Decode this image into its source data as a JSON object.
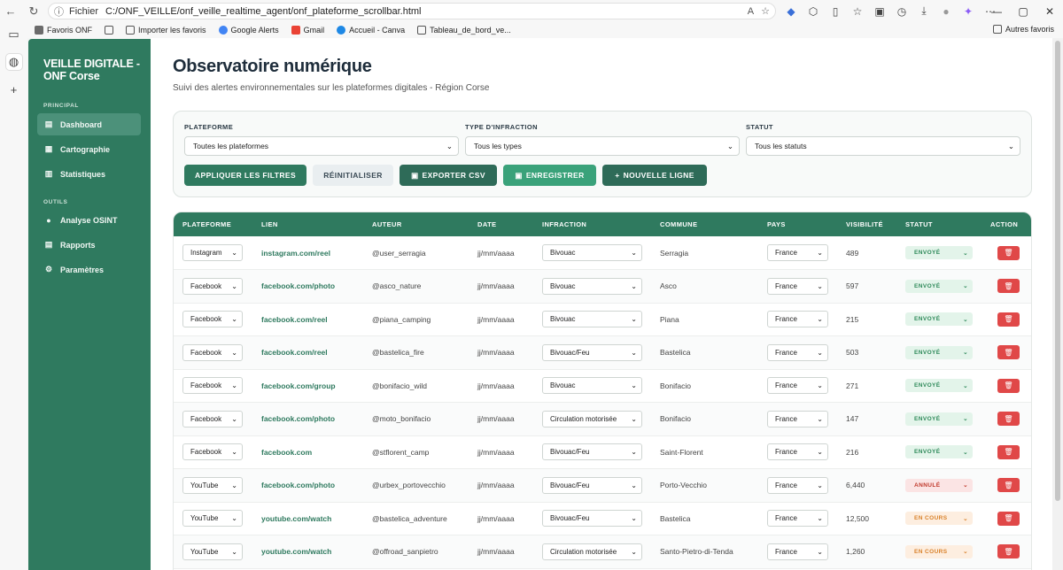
{
  "browser": {
    "url_label": "Fichier",
    "url": "C:/ONF_VEILLE/onf_veille_realtime_agent/onf_plateforme_scrollbar.html",
    "bookmarks": [
      "Favoris ONF",
      "Importer les favoris",
      "Google Alerts",
      "Gmail",
      "Accueil - Canva",
      "Tableau_de_bord_ve..."
    ],
    "other_bookmarks": "Autres favoris"
  },
  "sidebar": {
    "brand": "VEILLE DIGITALE - ONF Corse",
    "section_principal": "PRINCIPAL",
    "section_outils": "OUTILS",
    "principal_items": [
      {
        "label": "Dashboard",
        "icon": "chart-icon"
      },
      {
        "label": "Cartographie",
        "icon": "map-icon"
      },
      {
        "label": "Statistiques",
        "icon": "stats-icon"
      }
    ],
    "outils_items": [
      {
        "label": "Analyse OSINT",
        "icon": "dot-icon"
      },
      {
        "label": "Rapports",
        "icon": "report-icon"
      },
      {
        "label": "Paramètres",
        "icon": "gear-icon"
      }
    ]
  },
  "header": {
    "title": "Observatoire numérique",
    "subtitle": "Suivi des alertes environnementales sur les plateformes digitales - Région Corse"
  },
  "filters": {
    "platform_label": "PLATEFORME",
    "platform_value": "Toutes les plateformes",
    "type_label": "TYPE D'INFRACTION",
    "type_value": "Tous les types",
    "status_label": "STATUT",
    "status_value": "Tous les statuts",
    "apply": "APPLIQUER LES FILTRES",
    "reset": "RÉINITIALISER",
    "export": "EXPORTER CSV",
    "save": "ENREGISTRER",
    "new_line": "NOUVELLE LIGNE"
  },
  "table": {
    "headers": [
      "PLATEFORME",
      "LIEN",
      "AUTEUR",
      "DATE",
      "INFRACTION",
      "COMMUNE",
      "PAYS",
      "VISIBILITÉ",
      "STATUT",
      "ACTION"
    ],
    "rows": [
      {
        "platform": "Instagram",
        "link": "instagram.com/reel",
        "author": "@user_serragia",
        "date": "jj/mm/aaaa",
        "infraction": "Bivouac",
        "commune": "Serragia",
        "country": "France",
        "visibility": "489",
        "status": "ENVOYÉ",
        "status_kind": "envoye"
      },
      {
        "platform": "Facebook",
        "link": "facebook.com/photo",
        "author": "@asco_nature",
        "date": "jj/mm/aaaa",
        "infraction": "Bivouac",
        "commune": "Asco",
        "country": "France",
        "visibility": "597",
        "status": "ENVOYÉ",
        "status_kind": "envoye"
      },
      {
        "platform": "Facebook",
        "link": "facebook.com/reel",
        "author": "@piana_camping",
        "date": "jj/mm/aaaa",
        "infraction": "Bivouac",
        "commune": "Piana",
        "country": "France",
        "visibility": "215",
        "status": "ENVOYÉ",
        "status_kind": "envoye"
      },
      {
        "platform": "Facebook",
        "link": "facebook.com/reel",
        "author": "@bastelica_fire",
        "date": "jj/mm/aaaa",
        "infraction": "Bivouac/Feu",
        "commune": "Bastelica",
        "country": "France",
        "visibility": "503",
        "status": "ENVOYÉ",
        "status_kind": "envoye"
      },
      {
        "platform": "Facebook",
        "link": "facebook.com/group",
        "author": "@bonifacio_wild",
        "date": "jj/mm/aaaa",
        "infraction": "Bivouac",
        "commune": "Bonifacio",
        "country": "France",
        "visibility": "271",
        "status": "ENVOYÉ",
        "status_kind": "envoye"
      },
      {
        "platform": "Facebook",
        "link": "facebook.com/photo",
        "author": "@moto_bonifacio",
        "date": "jj/mm/aaaa",
        "infraction": "Circulation motorisée",
        "commune": "Bonifacio",
        "country": "France",
        "visibility": "147",
        "status": "ENVOYÉ",
        "status_kind": "envoye"
      },
      {
        "platform": "Facebook",
        "link": "facebook.com",
        "author": "@stflorent_camp",
        "date": "jj/mm/aaaa",
        "infraction": "Bivouac/Feu",
        "commune": "Saint-Florent",
        "country": "France",
        "visibility": "216",
        "status": "ENVOYÉ",
        "status_kind": "envoye"
      },
      {
        "platform": "YouTube",
        "link": "facebook.com/photo",
        "author": "@urbex_portovecchio",
        "date": "jj/mm/aaaa",
        "infraction": "Bivouac/Feu",
        "commune": "Porto-Vecchio",
        "country": "France",
        "visibility": "6,440",
        "status": "ANNULÉ",
        "status_kind": "annule"
      },
      {
        "platform": "YouTube",
        "link": "youtube.com/watch",
        "author": "@bastelica_adventure",
        "date": "jj/mm/aaaa",
        "infraction": "Bivouac/Feu",
        "commune": "Bastelica",
        "country": "France",
        "visibility": "12,500",
        "status": "EN COURS",
        "status_kind": "encours"
      },
      {
        "platform": "YouTube",
        "link": "youtube.com/watch",
        "author": "@offroad_sanpietro",
        "date": "jj/mm/aaaa",
        "infraction": "Circulation motorisée",
        "commune": "Santo-Pietro-di-Tenda",
        "country": "France",
        "visibility": "1,260",
        "status": "EN COURS",
        "status_kind": "encours"
      }
    ]
  }
}
